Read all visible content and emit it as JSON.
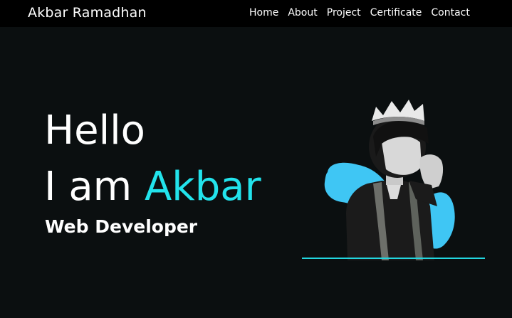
{
  "navbar": {
    "brand": "Akbar Ramadhan",
    "links": [
      "Home",
      "About",
      "Project",
      "Certificate",
      "Contact"
    ]
  },
  "hero": {
    "greeting": "Hello",
    "intro_prefix": "I am ",
    "intro_name": "Akbar",
    "role": "Web Developer"
  },
  "colors": {
    "background": "#0b0f10",
    "navbar": "#000000",
    "accent": "#22e3ec",
    "blob": "#3fc6f4"
  },
  "icons": {
    "portrait": "person-photo"
  }
}
